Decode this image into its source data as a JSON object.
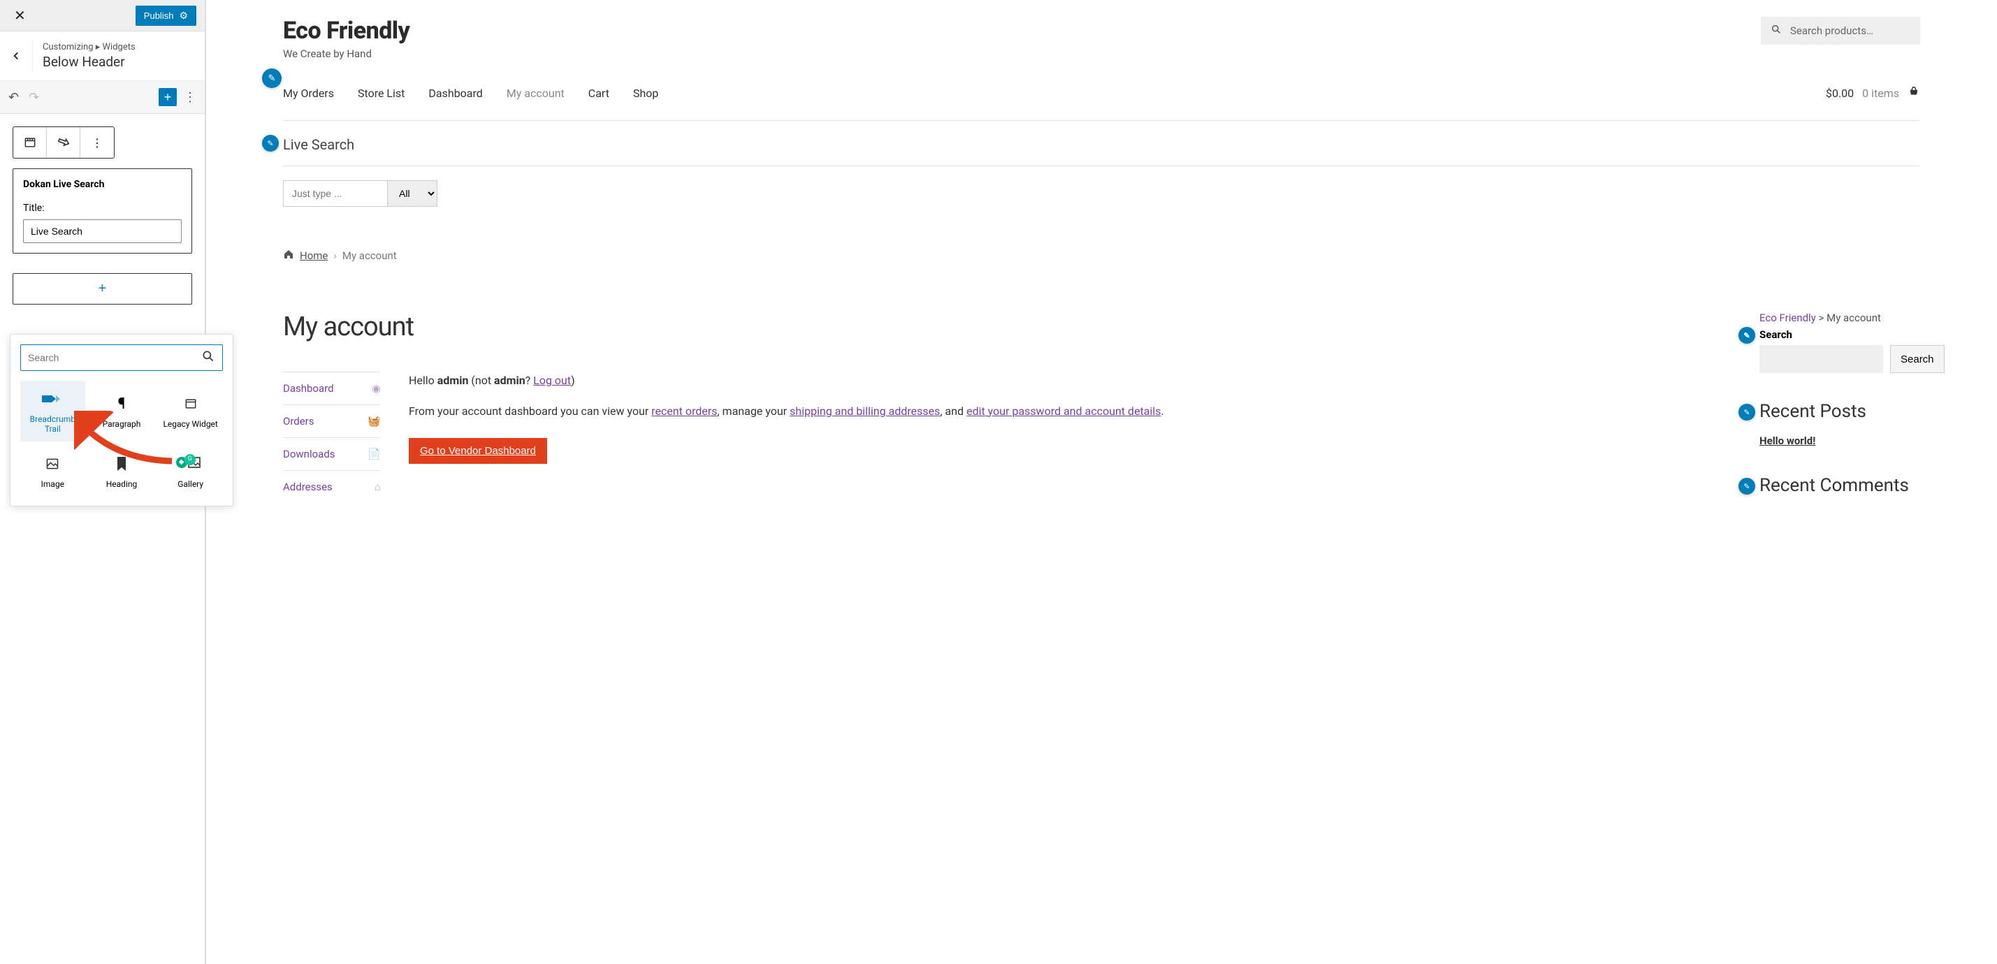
{
  "sidebar": {
    "publish_label": "Publish",
    "crumb_prefix": "Customizing",
    "crumb_section": "Widgets",
    "crumb_title": "Below Header",
    "widget_box_title": "Dokan Live Search",
    "title_field_label": "Title:",
    "title_field_value": "Live Search"
  },
  "inserter": {
    "search_placeholder": "Search",
    "blocks": [
      {
        "label": "Breadcrumb Trail",
        "icon": "breadcrumb"
      },
      {
        "label": "Paragraph",
        "icon": "pilcrow"
      },
      {
        "label": "Legacy Widget",
        "icon": "calendar"
      },
      {
        "label": "Image",
        "icon": "image"
      },
      {
        "label": "Heading",
        "icon": "bookmark"
      },
      {
        "label": "Gallery",
        "icon": "gallery"
      }
    ]
  },
  "preview": {
    "site_title": "Eco Friendly",
    "site_tagline": "We Create by Hand",
    "search_placeholder": "Search products…",
    "nav": [
      "My Orders",
      "Store List",
      "Dashboard",
      "My account",
      "Cart",
      "Shop"
    ],
    "nav_active_index": 3,
    "cart_total": "$0.00",
    "cart_items": "0 items",
    "live_search_title": "Live Search",
    "live_search_placeholder": "Just type ...",
    "live_search_select": "All",
    "breadcrumb_home": "Home",
    "breadcrumb_current": "My account",
    "page_title": "My account",
    "hello_prefix": "Hello ",
    "hello_user": "admin",
    "hello_not_prefix": " (not ",
    "hello_not_user": "admin",
    "hello_q": "? ",
    "logout": "Log out",
    "hello_close": ")",
    "dash_line1a": "From your account dashboard you can view your ",
    "dash_link1": "recent orders",
    "dash_line1b": ", manage your ",
    "dash_link2": "shipping and billing addresses",
    "dash_line1c": ", and ",
    "dash_link3": "edit your password and account details",
    "dash_line1d": ".",
    "vendor_btn": "Go to Vendor Dashboard",
    "acct_nav": [
      "Dashboard",
      "Orders",
      "Downloads",
      "Addresses"
    ],
    "aside_crumb_site": "Eco Friendly",
    "aside_crumb_sep": " > ",
    "aside_crumb_cur": "My account",
    "aside_search_label": "Search",
    "aside_search_btn": "Search",
    "aside_recent_posts": "Recent Posts",
    "aside_hello_world": "Hello world!",
    "aside_recent_comments": "Recent Comments"
  }
}
